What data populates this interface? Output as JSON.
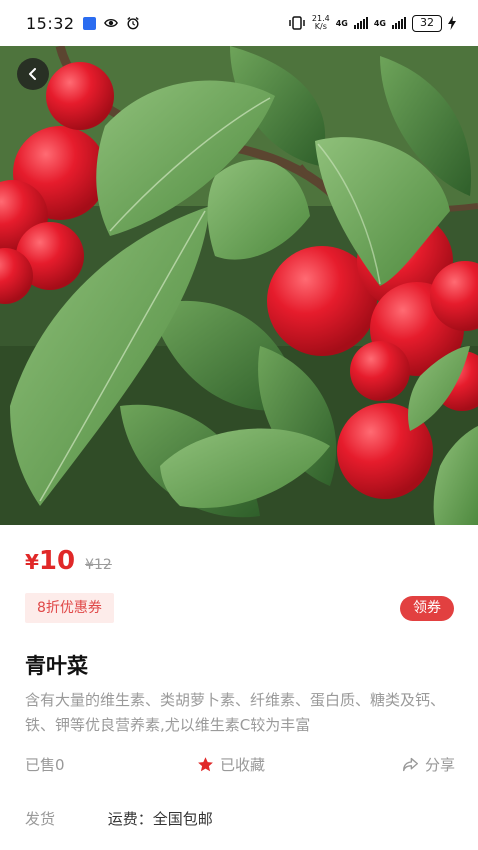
{
  "status_bar": {
    "time": "15:32",
    "speed_top": "21.4",
    "speed_bottom": "K/s",
    "net1": "4G",
    "net2": "4G",
    "battery": "32",
    "icons": [
      "usb-icon",
      "eye-icon",
      "alarm-icon",
      "vibrate-icon",
      "signal-icon",
      "battery-icon",
      "charging-icon"
    ]
  },
  "product": {
    "image_alt": "crabapple-fruit-photo",
    "price_symbol": "¥",
    "price": "10",
    "old_price": "¥12",
    "discount_tag": "8折优惠券",
    "coupon_button": "领券",
    "title": "青叶菜",
    "description": "含有大量的维生素、类胡萝卜素、纤维素、蛋白质、糖类及钙、铁、钾等优良营养素,尤以维生素C较为丰富",
    "sold": "已售0",
    "favorite": "已收藏",
    "share": "分享"
  },
  "shipping": {
    "label": "发货",
    "value": "运费：全国包邮"
  },
  "colors": {
    "price": "#e02828",
    "coupon_bg": "#e24040",
    "tag_bg": "#fdecea"
  }
}
